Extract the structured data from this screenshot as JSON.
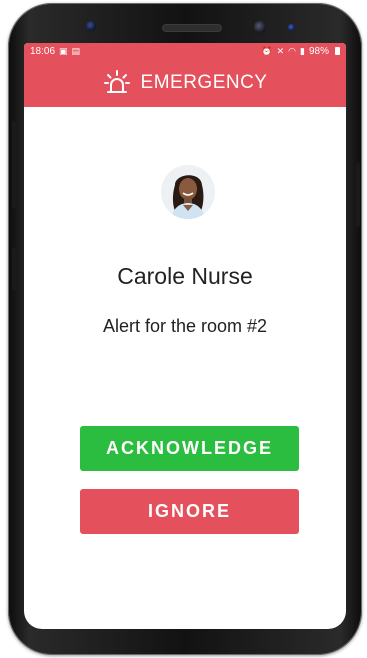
{
  "status_bar": {
    "time": "18:06",
    "battery": "98%",
    "left_icons": [
      "image-icon",
      "message-icon"
    ],
    "right_icons": [
      "alarm-clock-icon",
      "mute-icon",
      "wifi-icon",
      "signal-icon",
      "battery-icon"
    ]
  },
  "app_bar": {
    "title": "EMERGENCY",
    "icon": "siren-icon",
    "color": "#e4505b"
  },
  "alert": {
    "caller_name": "Carole Nurse",
    "message": "Alert for the room #2"
  },
  "actions": {
    "acknowledge_label": "ACKNOWLEDGE",
    "acknowledge_color": "#2bbd3f",
    "ignore_label": "IGNORE",
    "ignore_color": "#e4505b"
  }
}
